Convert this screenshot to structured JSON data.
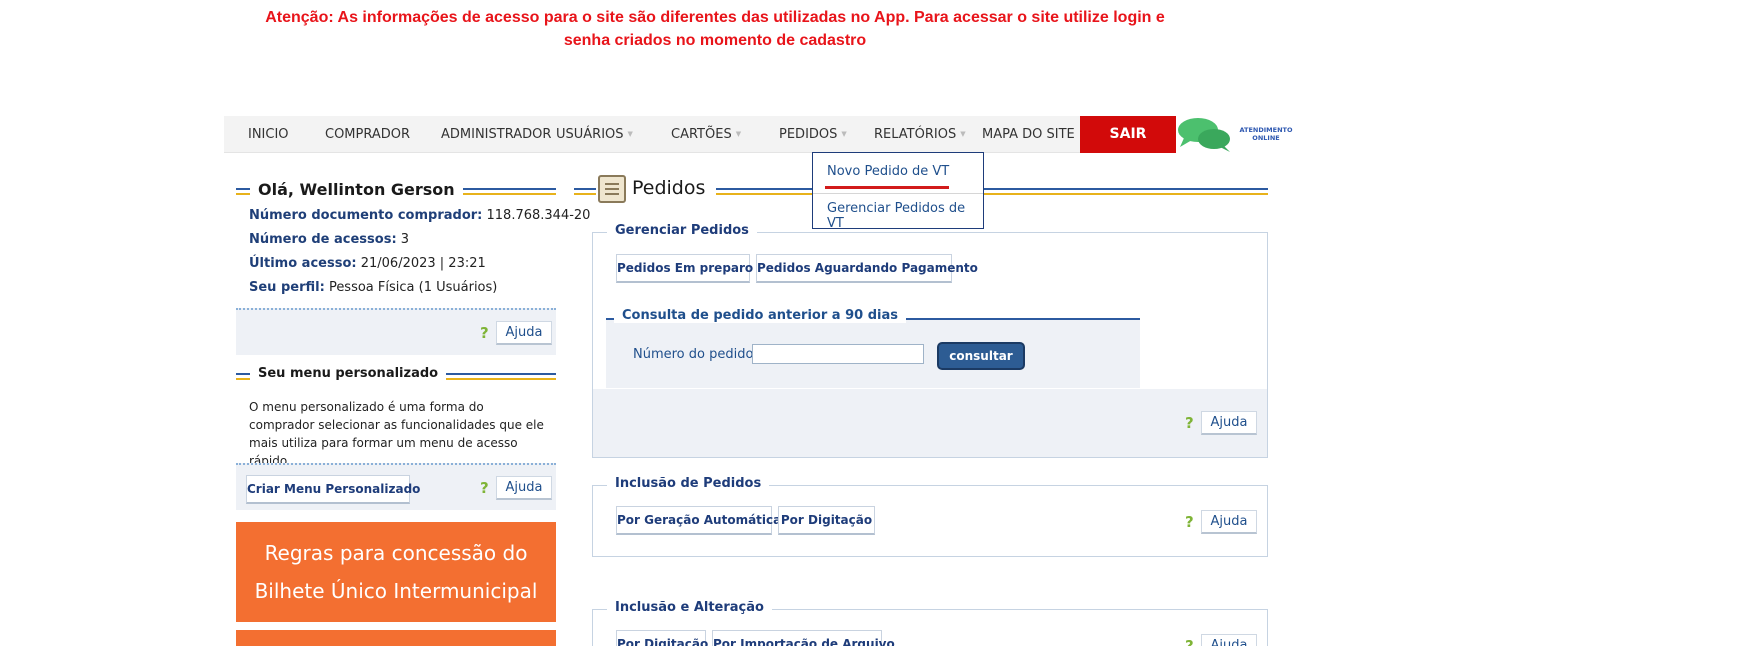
{
  "alert": {
    "text": "Atenção: As informações de acesso para o site são diferentes das utilizadas no App. Para acessar o site utilize login e senha criados no momento de cadastro"
  },
  "nav": {
    "items": [
      "INICIO",
      "COMPRADOR",
      "ADMINISTRADOR",
      "USUÁRIOS",
      "CARTÕES",
      "PEDIDOS",
      "RELATÓRIOS",
      "MAPA DO SITE"
    ],
    "sair": "SAIR",
    "chat_label": "ATENDIMENTO ONLINE",
    "chat_color": "#4cc06e"
  },
  "dropdown": {
    "items": [
      "Novo Pedido de VT",
      "Gerenciar Pedidos de VT"
    ]
  },
  "sidebar": {
    "greeting": "Olá, Wellinton Gerson",
    "info": [
      {
        "label": "Número documento comprador:",
        "value": "118.768.344-20"
      },
      {
        "label": "Número de acessos:",
        "value": "3"
      },
      {
        "label": "Último acesso:",
        "value": "21/06/2023 | 23:21"
      },
      {
        "label": "Seu perfil:",
        "value": "Pessoa Física (1 Usuários)"
      }
    ],
    "help": "Ajuda",
    "menu_title": "Seu menu personalizado",
    "menu_text": "O menu personalizado é uma forma do comprador selecionar as funcionalidades que ele mais utiliza para formar um menu de acesso rápido.",
    "criar_menu": "Criar Menu Personalizado",
    "banner": "Regras para concessão do Bilhete Único Intermunicipal",
    "accent_orange": "#f36f31"
  },
  "main": {
    "title": "Pedidos",
    "gerenciar": {
      "legend": "Gerenciar Pedidos",
      "buttons": [
        "Pedidos Em preparo",
        "Pedidos Aguardando Pagamento"
      ],
      "consulta_legend": "Consulta de pedido anterior a 90 dias",
      "numero_label": "Número do pedido",
      "numero_value": "",
      "consultar": "consultar"
    },
    "inclusao": {
      "legend": "Inclusão de Pedidos",
      "buttons": [
        "Por Geração Automática",
        "Por Digitação"
      ]
    },
    "alteracao": {
      "legend": "Inclusão e Alteração",
      "buttons": [
        "Por Digitação",
        "Por Importação de Arquivo"
      ]
    },
    "help": "Ajuda"
  }
}
